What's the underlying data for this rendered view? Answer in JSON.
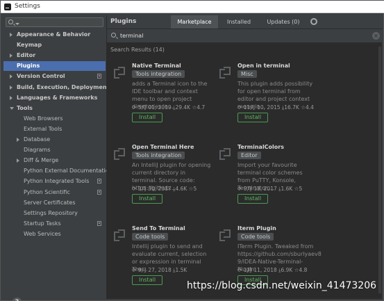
{
  "window": {
    "title": "Settings"
  },
  "sidebar": {
    "items": [
      {
        "label": "Appearance & Behavior",
        "bold": true,
        "arrow": "right",
        "indent": 0
      },
      {
        "label": "Keymap",
        "bold": true,
        "arrow": "",
        "indent": 0
      },
      {
        "label": "Editor",
        "bold": true,
        "arrow": "right",
        "indent": 0
      },
      {
        "label": "Plugins",
        "bold": true,
        "arrow": "",
        "indent": 0,
        "selected": true
      },
      {
        "label": "Version Control",
        "bold": true,
        "arrow": "right",
        "indent": 0,
        "copy": true
      },
      {
        "label": "Build, Execution, Deployment",
        "bold": true,
        "arrow": "right",
        "indent": 0
      },
      {
        "label": "Languages & Frameworks",
        "bold": true,
        "arrow": "right",
        "indent": 0
      },
      {
        "label": "Tools",
        "bold": true,
        "arrow": "down",
        "indent": 0
      },
      {
        "label": "Web Browsers",
        "bold": false,
        "arrow": "",
        "indent": 1
      },
      {
        "label": "External Tools",
        "bold": false,
        "arrow": "",
        "indent": 1
      },
      {
        "label": "Database",
        "bold": false,
        "arrow": "right",
        "indent": 1
      },
      {
        "label": "Diagrams",
        "bold": false,
        "arrow": "",
        "indent": 1
      },
      {
        "label": "Diff & Merge",
        "bold": false,
        "arrow": "right",
        "indent": 1
      },
      {
        "label": "Python External Documentation",
        "bold": false,
        "arrow": "",
        "indent": 1
      },
      {
        "label": "Python Integrated Tools",
        "bold": false,
        "arrow": "",
        "indent": 1,
        "copy": true
      },
      {
        "label": "Python Scientific",
        "bold": false,
        "arrow": "",
        "indent": 1,
        "copy": true
      },
      {
        "label": "Server Certificates",
        "bold": false,
        "arrow": "",
        "indent": 1
      },
      {
        "label": "Settings Repository",
        "bold": false,
        "arrow": "",
        "indent": 1
      },
      {
        "label": "Startup Tasks",
        "bold": false,
        "arrow": "",
        "indent": 1,
        "copy": true
      },
      {
        "label": "Web Services",
        "bold": false,
        "arrow": "",
        "indent": 1
      }
    ],
    "help_label": "?"
  },
  "main": {
    "title": "Plugins",
    "tabs": [
      {
        "label": "Marketplace",
        "active": true
      },
      {
        "label": "Installed",
        "active": false
      },
      {
        "label": "Updates (0)",
        "active": false
      }
    ],
    "search_query": "terminal",
    "results_label": "Search Results (14)",
    "plugins": [
      {
        "name": "Native Terminal",
        "tag": "Tools integration",
        "description": "adds a Terminal icon to the IDE toolbar and context menu to open project directories in...",
        "date": "5月 01, 2019",
        "downloads": "29.4K",
        "rating": "4.7",
        "install_label": "Install"
      },
      {
        "name": "Open in terminal",
        "tag": "Misc",
        "description": "This plugin adds possibility for open terminal from editor and project context menu in...",
        "date": "11月 10, 2015",
        "downloads": "16.7K",
        "rating": "4.4",
        "install_label": "Install"
      },
      {
        "name": "Open Terminal Here",
        "tag": "Tools integration",
        "description": "An IntelliJ plugin for opening current directory in terminal. Source code: https://github...",
        "date": "3月 30, 2017",
        "downloads": "4.6K",
        "rating": "5",
        "install_label": "Install"
      },
      {
        "name": "TerminalColors",
        "tag": "Editor",
        "description": "Import your favourite terminal color schemes from PuTTY, Konsole, Terminator,...",
        "date": "9月 13, 2017",
        "downloads": "1.6K",
        "rating": "5",
        "install_label": "Install"
      },
      {
        "name": "Send To Terminal",
        "tag": "Code tools",
        "description": "Intellij plugin to send and evaluate current, selection or expression in terminal The...",
        "date": "9月 27, 2018",
        "downloads": "1.5K",
        "rating": "",
        "install_label": "Install"
      },
      {
        "name": "Iterm Plugin",
        "tag": "Code tools",
        "description": "ITerm Plugin. Tweaked from https://github.com/sburlyaev8 9/IDEA-Native-Terminal-Plugin.",
        "date": "1月 11, 2018",
        "downloads": "6.9K",
        "rating": "4.8",
        "install_label": "Install"
      }
    ]
  },
  "watermark": "https://blog.csdn.net/weixin_41473206"
}
